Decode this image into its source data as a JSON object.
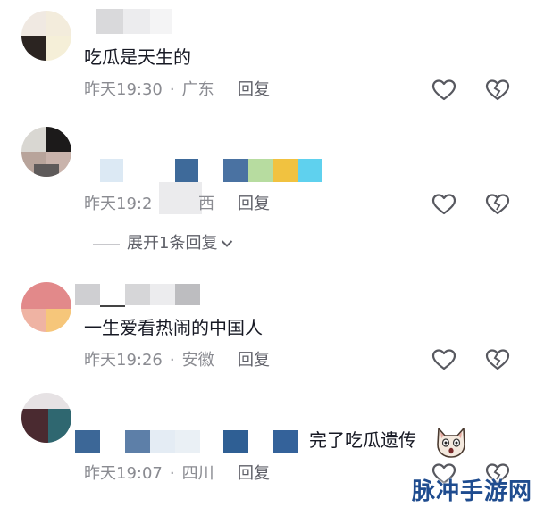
{
  "comments": [
    {
      "text": "吃瓜是天生的",
      "time": "昨天19:30",
      "location": "广东",
      "reply_label": "回复"
    },
    {
      "text": "",
      "time": "昨天19:2",
      "location": "西",
      "reply_label": "回复",
      "expand_label": "展开1条回复"
    },
    {
      "text": "一生爱看热闹的中国人",
      "time": "昨天19:26",
      "location": "安徽",
      "reply_label": "回复"
    },
    {
      "text": "完了吃瓜遗传",
      "time": "昨天19:07",
      "location": "四川",
      "reply_label": "回复"
    }
  ],
  "watermark": "脉冲手游网",
  "icons": {
    "like": "heart-outline-icon",
    "dislike": "broken-heart-icon",
    "expand": "chevron-down-icon"
  }
}
